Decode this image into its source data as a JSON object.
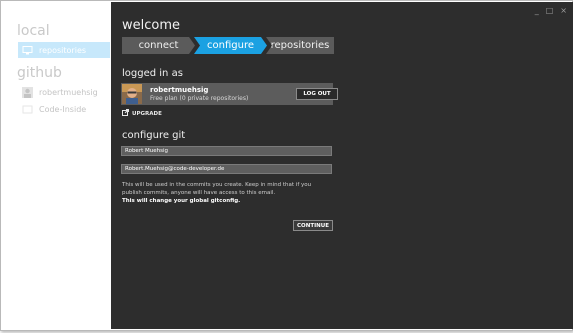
{
  "window": {
    "minimize": "_",
    "maximize": "□",
    "close": "×"
  },
  "sidebar": {
    "local_title": "local",
    "local_items": [
      {
        "label": "repositories"
      }
    ],
    "github_title": "github",
    "github_items": [
      {
        "label": "robertmuehsig"
      },
      {
        "label": "Code-Inside"
      }
    ]
  },
  "main": {
    "title": "welcome",
    "steps": [
      {
        "label": "connect"
      },
      {
        "label": "configure"
      },
      {
        "label": "repositories"
      }
    ],
    "logged_in_heading": "logged in as",
    "account": {
      "name": "robertmuehsig",
      "plan": "Free plan (0 private repositories)",
      "logout_label": "LOG OUT"
    },
    "upgrade_label": "UPGRADE",
    "configure_heading": "configure git",
    "name_value": "Robert Muehsig",
    "email_value": "Robert.Muehsig@code-developer.de",
    "note_text": "This will be used in the commits you create. Keep in mind that if you publish commits, anyone will have access to this email.",
    "note_bold": "This will change your global gitconfig.",
    "continue_label": "CONTINUE"
  },
  "colors": {
    "accent": "#1ba1e2",
    "selected": "#c7e8fb",
    "background": "#2d2d2d"
  }
}
